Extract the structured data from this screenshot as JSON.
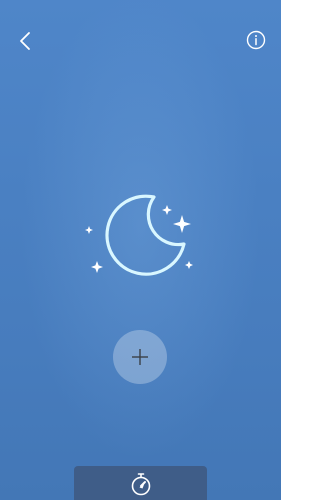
{
  "screen": {
    "background_color": "#4a80c2",
    "accent_color": "#d9f7ff",
    "bottom_bar_color": "#3f5d88"
  },
  "header": {
    "back_icon": "chevron-left-icon",
    "info_icon": "info-circle-icon"
  },
  "illustration": {
    "icon": "moon-stars-icon"
  },
  "actions": {
    "add_icon": "plus-icon"
  },
  "bottom_bar": {
    "timer_icon": "stopwatch-icon"
  }
}
